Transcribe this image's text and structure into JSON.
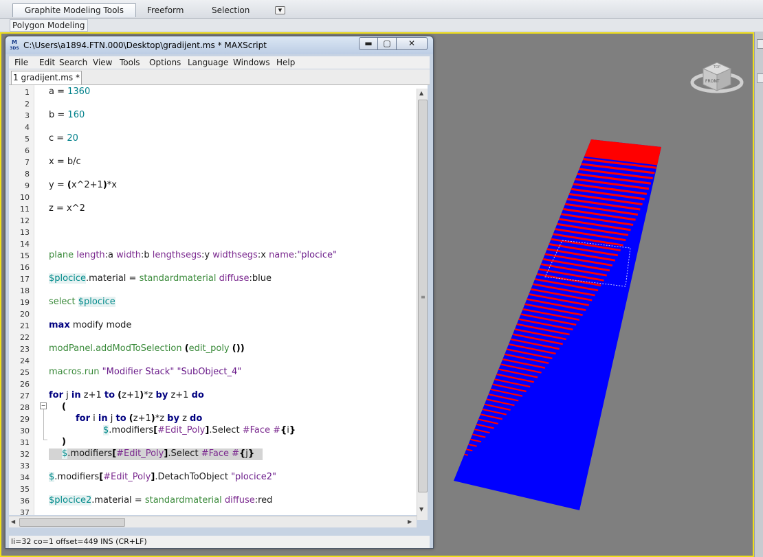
{
  "ribbon": {
    "tabs": [
      "Graphite Modeling Tools",
      "Freeform",
      "Selection"
    ],
    "panel_label": "Polygon Modeling"
  },
  "viewcube": {
    "face_label": "FRONT",
    "top_label": "TOP"
  },
  "maxscript_window": {
    "title": "C:\\Users\\a1894.FTN.000\\Desktop\\gradijent.ms * MAXScript",
    "app_icon": "M",
    "menu": [
      "File",
      "Edit",
      "Search",
      "View",
      "Tools",
      "Options",
      "Language",
      "Windows",
      "Help"
    ],
    "tab_label": "1 gradijent.ms *",
    "status": "li=32 co=1 offset=449 INS (CR+LF)"
  },
  "editor": {
    "line_numbers": [
      "1",
      "2",
      "3",
      "4",
      "5",
      "6",
      "7",
      "8",
      "9",
      "10",
      "11",
      "12",
      "13",
      "14",
      "15",
      "16",
      "17",
      "18",
      "19",
      "20",
      "21",
      "22",
      "23",
      "24",
      "25",
      "26",
      "27",
      "28",
      "29",
      "30",
      "31",
      "32",
      "33",
      "34",
      "35",
      "36",
      "37"
    ],
    "lines": [
      "a = 1360",
      "b = 160",
      "c = 20",
      "x = b/c",
      "y = (x^2+1)*x",
      "z = x^2",
      "plane length:a width:b lengthsegs:y widthsegs:x name:\"plocice\"",
      "$plocice.material = standardmaterial diffuse:blue",
      "select $plocice",
      "max modify mode",
      "modPanel.addModToSelection (edit_poly ())",
      "macros.run \"Modifier Stack\" \"SubObject_4\"",
      "for j in z+1 to (z+1)*z by z+1 do",
      "(",
      "for i in j to (z+1)*z by z do",
      "$.modifiers[#Edit_Poly].Select #Face #{i}",
      ")",
      "$.modifiers[#Edit_Poly].Select #Face #{j}",
      "$.modifiers[#Edit_Poly].DetachToObject \"plocice2\"",
      "$plocice2.material = standardmaterial diffuse:red"
    ]
  },
  "colors": {
    "viewport_border": "#f0df1a",
    "plane_blue": "#0000ff",
    "plane_red": "#ff0000"
  }
}
